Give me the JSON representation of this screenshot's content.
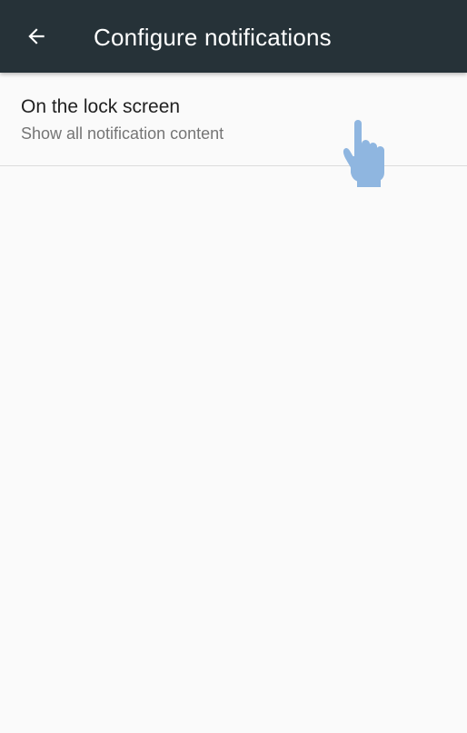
{
  "app_bar": {
    "title": "Configure notifications",
    "back_icon": "arrow-back-icon",
    "background_color": "#263238"
  },
  "preferences": [
    {
      "title": "On the lock screen",
      "summary": "Show all notification content"
    }
  ],
  "overlay": {
    "icon": "pointing-hand-icon",
    "color": "#8fb6e0"
  }
}
